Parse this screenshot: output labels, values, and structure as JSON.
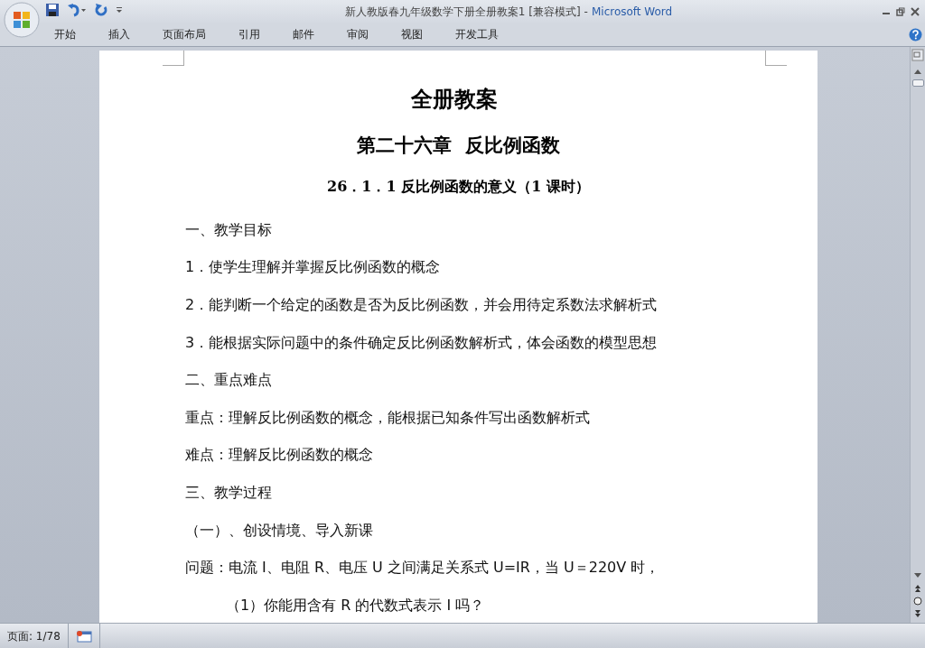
{
  "window": {
    "title": "新人教版春九年级数学下册全册教案1 [兼容模式]",
    "separator": "-",
    "app": "Microsoft Word"
  },
  "ribbon_tabs": [
    {
      "label": "开始",
      "selected": false
    },
    {
      "label": "插入",
      "selected": false
    },
    {
      "label": "页面布局",
      "selected": false
    },
    {
      "label": "引用",
      "selected": false
    },
    {
      "label": "邮件",
      "selected": false
    },
    {
      "label": "审阅",
      "selected": false
    },
    {
      "label": "视图",
      "selected": false
    },
    {
      "label": "开发工具",
      "selected": false
    }
  ],
  "document": {
    "paragraphs": [
      {
        "kind": "title",
        "text": "全册教案 "
      },
      {
        "kind": "heading",
        "text": "第二十六章  反比例函数"
      },
      {
        "kind": "subheading",
        "text": "26．1．1 反比例函数的意义（1 课时）"
      },
      {
        "kind": "body",
        "text": "一、教学目标"
      },
      {
        "kind": "body",
        "text": "1．使学生理解并掌握反比例函数的概念"
      },
      {
        "kind": "body",
        "text": "2．能判断一个给定的函数是否为反比例函数，并会用待定系数法求解析式"
      },
      {
        "kind": "body",
        "text": "3．能根据实际问题中的条件确定反比例函数解析式，体会函数的模型思想"
      },
      {
        "kind": "body",
        "text": "二、重点难点"
      },
      {
        "kind": "body",
        "text": "重点：理解反比例函数的概念，能根据已知条件写出函数解析式"
      },
      {
        "kind": "body",
        "text": "难点：理解反比例函数的概念"
      },
      {
        "kind": "body",
        "text": "三、教学过程"
      },
      {
        "kind": "body",
        "text": "（一）、创设情境、导入新课"
      },
      {
        "kind": "body",
        "text": "问题：电流 I、电阻 R、电压 U 之间满足关系式 U=IR，当 U＝220V 时，"
      },
      {
        "kind": "indent",
        "text": "（1）你能用含有 R 的代数式表示 I 吗？"
      }
    ]
  },
  "status_bar": {
    "page": "页面: 1/78"
  }
}
